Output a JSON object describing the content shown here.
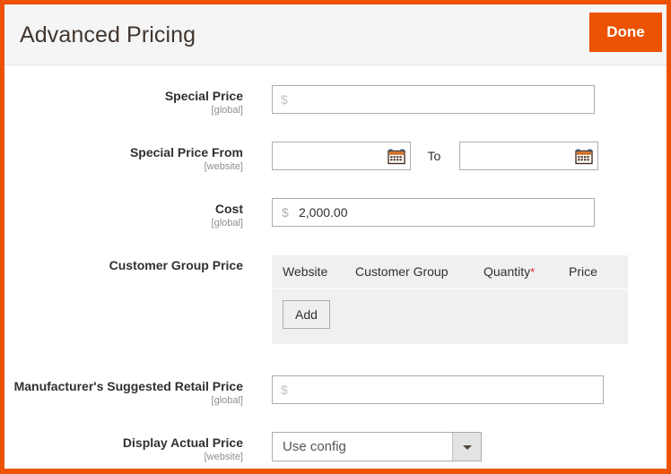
{
  "header": {
    "title": "Advanced Pricing",
    "done_label": "Done",
    "accent_color": "#eb5202",
    "background": "#f5f5f5"
  },
  "fields": {
    "special_price": {
      "label": "Special Price",
      "scope": "[global]",
      "placeholder": "$",
      "value": ""
    },
    "special_price_from": {
      "label": "Special Price From",
      "scope": "[website]",
      "from_value": "",
      "to_label": "To",
      "to_value": "",
      "calendar_icon": "calendar-icon"
    },
    "cost": {
      "label": "Cost",
      "scope": "[global]",
      "currency_symbol": "$",
      "value": "2,000.00"
    },
    "customer_group_price": {
      "label": "Customer Group Price",
      "columns": [
        "Website",
        "Customer Group",
        "Quantity",
        "Price"
      ],
      "required_column": "Quantity",
      "required_marker": "*",
      "required_color": "#e02b27",
      "rows": [],
      "add_label": "Add"
    },
    "msrp": {
      "label": "Manufacturer's Suggested Retail Price",
      "scope": "[global]",
      "placeholder": "$",
      "value": ""
    },
    "display_actual_price": {
      "label": "Display Actual Price",
      "scope": "[website]",
      "selected": "Use config",
      "caret_icon": "chevron-down-icon"
    }
  }
}
